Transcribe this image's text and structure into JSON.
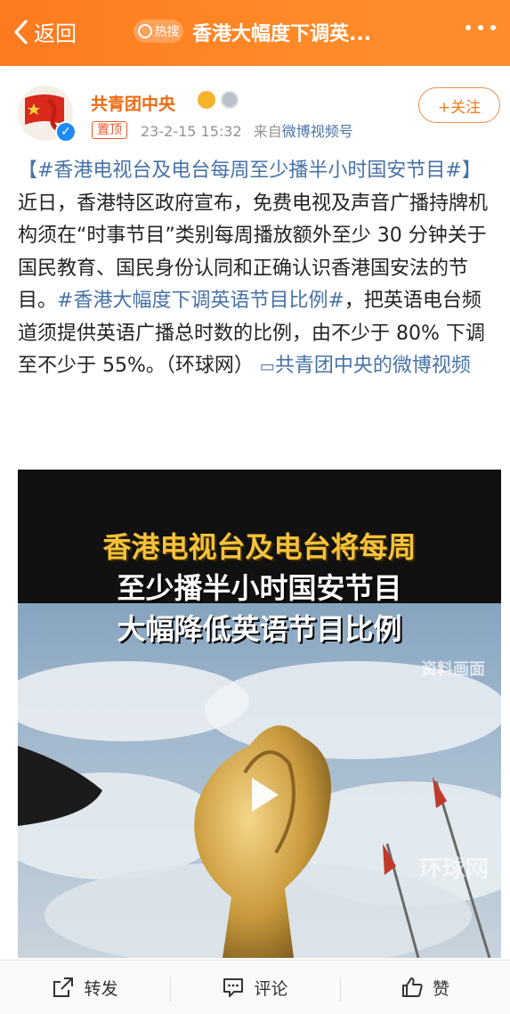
{
  "header": {
    "back_label": "返回",
    "hot_badge": "热搜",
    "title": "香港大幅度下调英..."
  },
  "post": {
    "username": "共青团中央",
    "pinned_label": "置顶",
    "timestamp": "23-2-15 15:32",
    "source_prefix": "来自",
    "source": "微博视频号",
    "follow_label": "+关注",
    "text": {
      "tag1": "【#香港电视台及电台每周至少播半小时国安节目#】",
      "body1": "近日，香港特区政府宣布，免费电视及声音广播持牌机构须在“时事节目”类别每周播放额外至少 30 分钟关于国民教育、国民身份认同和正确认识香港国安法的节目。",
      "tag2": "#香港大幅度下调英语节目比例#",
      "body2": "，把英语电台频道须提供英语广播总时数的比例，由不少于 80% 下调至不少于 55%。（环球网）",
      "link": "共青团中央的微博视频"
    }
  },
  "video": {
    "caption_line1": "香港电视台及电台将每周",
    "caption_line2": "至少播半小时国安节目",
    "caption_line3": "大幅降低英语节目比例",
    "watermark_top": "资料画面",
    "watermark_logo": "环球网"
  },
  "footer": {
    "repost_label": "转发",
    "comment_label": "评论",
    "like_label": "赞"
  },
  "colors": {
    "header_orange": "#ff8a28",
    "username_orange": "#ed6b12",
    "link_blue": "#4772a6"
  }
}
